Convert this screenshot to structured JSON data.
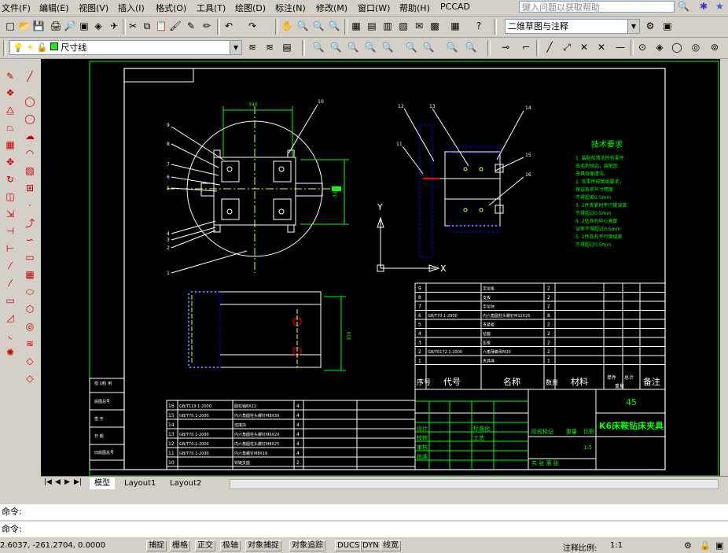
{
  "menubar": {
    "items": [
      "文件(F)",
      "编辑(E)",
      "视图(V)",
      "插入(I)",
      "格式(O)",
      "工具(T)",
      "绘图(D)",
      "标注(N)",
      "修改(M)",
      "窗口(W)",
      "帮助(H)",
      "PCCAD"
    ],
    "help_placeholder": "键入问题以获取帮助"
  },
  "toolbar1": {
    "workspace": "二维草图与注释"
  },
  "toolbar2": {
    "layer": "尺寸线"
  },
  "tabs": {
    "model": "模型",
    "layout1": "Layout1",
    "layout2": "Layout2"
  },
  "command": {
    "line1": "命令:",
    "line2": "命令:"
  },
  "status": {
    "coords": "2.6037, -261.2704, 0.0000",
    "buttons": [
      "捕捉",
      "栅格",
      "正交",
      "极轴",
      "对象捕捉",
      "对象追踪",
      "DUCS",
      "DYN",
      "线宽"
    ],
    "annot_label": "注释比例:",
    "annot_value": "1:1"
  },
  "drawing": {
    "tech_title": "技术要求",
    "tech_lines": [
      "1. 装配前清洗所有零件",
      "去毛刺锐边，装配后",
      "夹具各面清洁。",
      "2. 各零件按图纸要求，",
      "保证各项尺寸精度",
      "不得超差0.5mm",
      "3. 2件夹紧时平行度误差",
      "不得超过0.5mm",
      "4. 2处各孔中心高度",
      "误差不得超过0.5mm",
      "5. 2件各孔平行度误差",
      "不得超过0.5mm"
    ],
    "title_block_name": "K6床鞍钻床夹具",
    "title_block_material": "45",
    "parts_header": {
      "seq": "序号",
      "code": "代号",
      "name": "名称",
      "qty": "数量",
      "material": "材料",
      "single": "单件",
      "total": "总计",
      "weight": "重量",
      "remark": "备注"
    },
    "parts_upper": [
      {
        "seq": "9",
        "code": "",
        "name": "定位板",
        "qty": "2"
      },
      {
        "seq": "8",
        "code": "",
        "name": "支板",
        "qty": "2"
      },
      {
        "seq": "7",
        "code": "",
        "name": "定位块",
        "qty": "2"
      },
      {
        "seq": "6",
        "code": "GB/T70.1-2000",
        "name": "内六角圆柱头螺钉M12X25",
        "qty": "8"
      },
      {
        "seq": "5",
        "code": "",
        "name": "夹紧板",
        "qty": "2"
      },
      {
        "seq": "4",
        "code": "",
        "name": "钻套",
        "qty": "2"
      },
      {
        "seq": "3",
        "code": "",
        "name": "压板",
        "qty": "2"
      },
      {
        "seq": "2",
        "code": "GB/T6172.1-2000",
        "name": "六角薄螺母M20",
        "qty": "2"
      },
      {
        "seq": "1",
        "code": "",
        "name": "夹具体",
        "qty": "1"
      }
    ],
    "parts_lower": [
      {
        "seq": "16",
        "code": "GB/T119.1-2000",
        "name": "圆柱销8X22",
        "qty": "4"
      },
      {
        "seq": "15",
        "code": "GB/T70.1-2000",
        "name": "内六角圆柱头螺钉M8X30",
        "qty": "4"
      },
      {
        "seq": "14",
        "code": "",
        "name": "连接块",
        "qty": "4"
      },
      {
        "seq": "13",
        "code": "GB/T70.1-2000",
        "name": "内六角圆柱头螺钉M6X20",
        "qty": "4"
      },
      {
        "seq": "12",
        "code": "GB/T70.1-2000",
        "name": "内六角圆柱头螺钉M8X25",
        "qty": "4"
      },
      {
        "seq": "11",
        "code": "GB/T70.1-2000",
        "name": "内六角螺钉M8X16",
        "qty": "4"
      },
      {
        "seq": "10",
        "code": "",
        "name": "铰链支座",
        "qty": "2"
      }
    ],
    "side_block": [
      "借 (通) 用",
      "底图总号",
      "签  字",
      "日  期",
      "旧底图总号"
    ],
    "sign_block": {
      "designer": "设计",
      "checker": "校核",
      "std": "标准化",
      "craft": "工艺",
      "review": "审核",
      "approve": "批准",
      "marks": "阶段标记",
      "weight": "重量",
      "scale": "比例",
      "scale_val": "1:5",
      "sheet": "共  张  第  张"
    },
    "leaders": [
      "1",
      "2",
      "3",
      "4",
      "5",
      "6",
      "7",
      "8",
      "9",
      "10",
      "11",
      "12",
      "13",
      "14",
      "15",
      "16"
    ],
    "dim_top": "340",
    "dim_right": "320",
    "dim_right2": "350",
    "ucs_x": "X",
    "ucs_y": "Y"
  },
  "colors": {
    "canvas": "#000000",
    "border": "#00ff00",
    "frame": "#ffffff",
    "center": "#ffff00",
    "dimension": "#00ff00",
    "leader": "#ffffff",
    "part_body": "#0000ff"
  }
}
